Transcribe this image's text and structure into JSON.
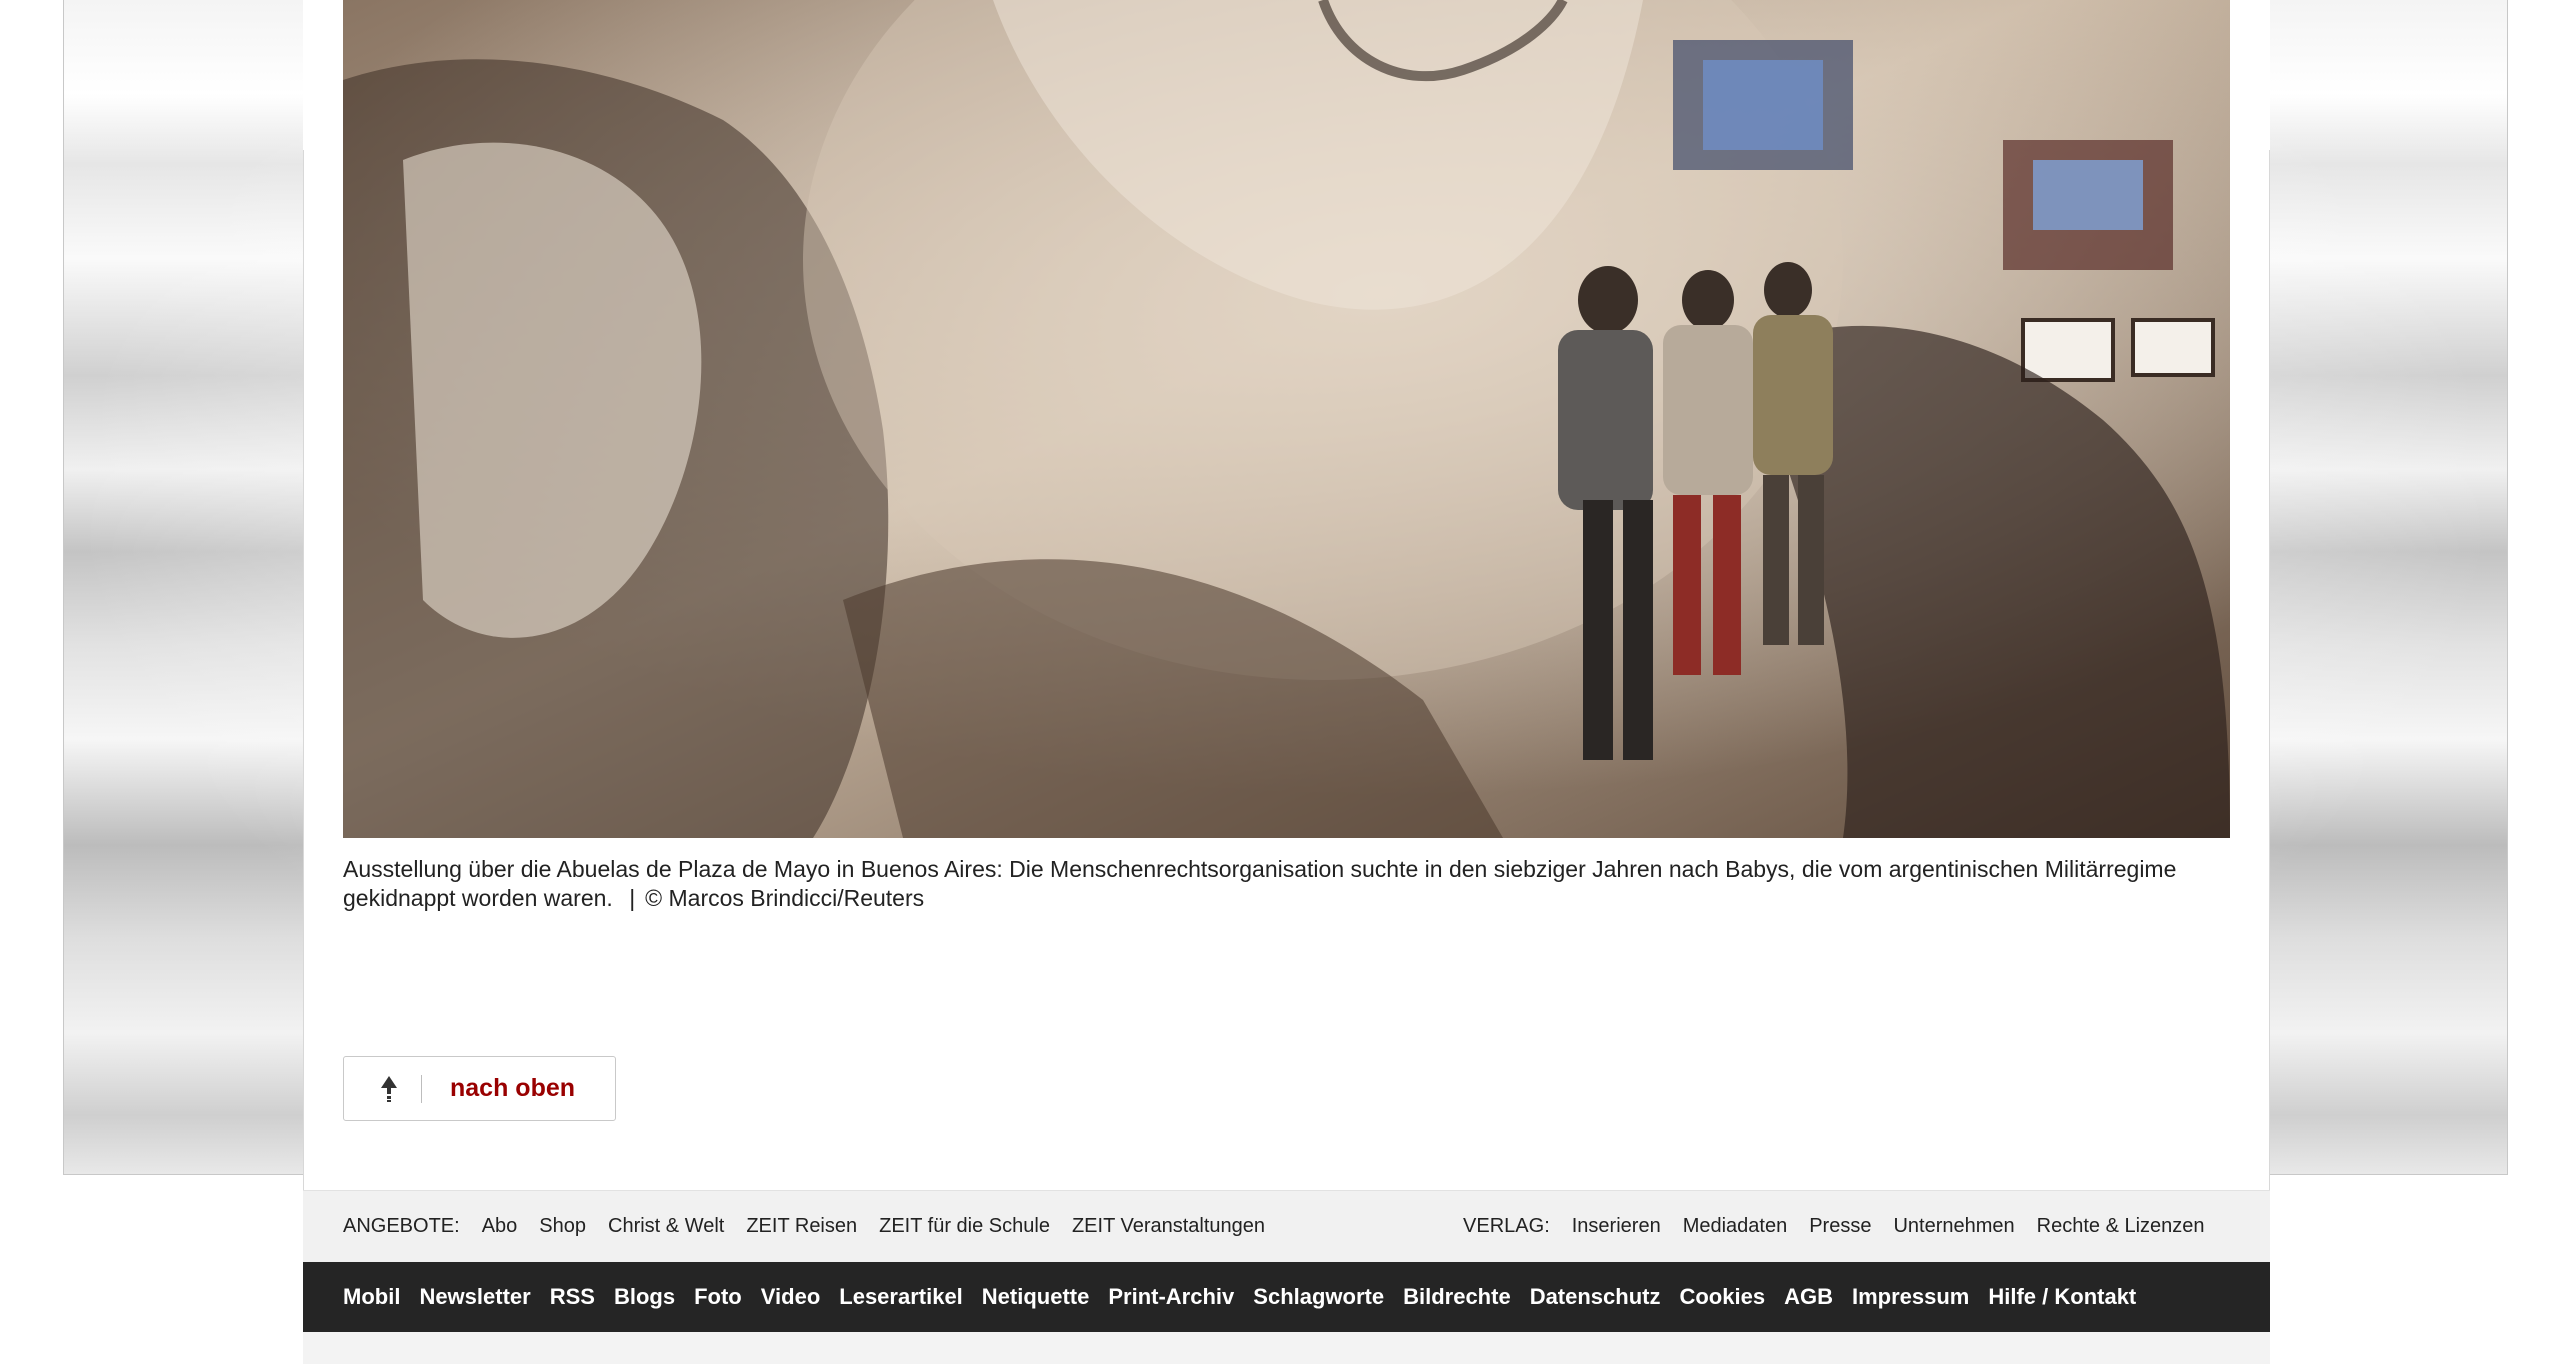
{
  "caption": {
    "text": "Ausstellung über die Abuelas de Plaza de Mayo in Buenos Aires: Die Menschenrechtsorganisation suchte in den siebziger Jahren nach Babys, die vom argentinischen Militärregime gekidnappt worden waren.",
    "separator": "|",
    "credit": "© Marcos Brindicci/Reuters"
  },
  "back_to_top": {
    "icon": "arrow-up-icon",
    "label": "nach oben"
  },
  "footer": {
    "offers": {
      "title": "ANGEBOTE:",
      "links": [
        "Abo",
        "Shop",
        "Christ & Welt",
        "ZEIT Reisen",
        "ZEIT für die Schule",
        "ZEIT Veranstaltungen"
      ]
    },
    "publisher": {
      "title": "VERLAG:",
      "links": [
        "Inserieren",
        "Mediadaten",
        "Presse",
        "Unternehmen",
        "Rechte & Lizenzen"
      ]
    },
    "main_links": [
      "Mobil",
      "Newsletter",
      "RSS",
      "Blogs",
      "Foto",
      "Video",
      "Leserartikel",
      "Netiquette",
      "Print-Archiv",
      "Schlagworte",
      "Bildrechte",
      "Datenschutz",
      "Cookies",
      "AGB",
      "Impressum",
      "Hilfe / Kontakt"
    ]
  },
  "colors": {
    "accent": "#990000",
    "footer_dark": "#252525",
    "footer_light": "#f1f1f1"
  }
}
